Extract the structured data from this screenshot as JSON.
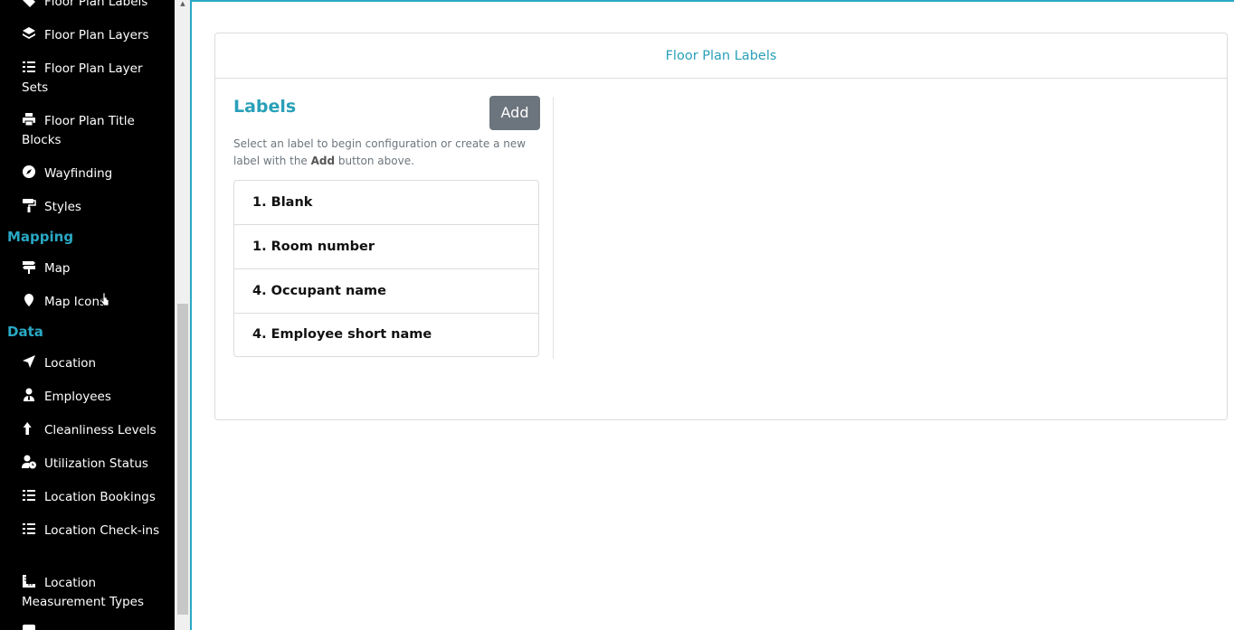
{
  "sidebar": {
    "items_top": [
      {
        "label": "Floor Plan Labels",
        "icon": "tag-icon"
      },
      {
        "label": "Floor Plan Layers",
        "icon": "layers-icon"
      },
      {
        "label": "Floor Plan Layer Sets",
        "icon": "list-check-icon"
      },
      {
        "label": "Floor Plan Title Blocks",
        "icon": "print-icon"
      },
      {
        "label": "Wayfinding",
        "icon": "compass-icon"
      },
      {
        "label": "Styles",
        "icon": "paint-roller-icon"
      }
    ],
    "section_mapping": "Mapping",
    "items_mapping": [
      {
        "label": "Map",
        "icon": "signpost-icon"
      },
      {
        "label": "Map Icons",
        "icon": "map-marker-icon"
      }
    ],
    "section_data": "Data",
    "items_data": [
      {
        "label": "Location",
        "icon": "location-arrow-icon"
      },
      {
        "label": "Employees",
        "icon": "user-tie-icon"
      },
      {
        "label": "Cleanliness Levels",
        "icon": "arrow-up-icon"
      },
      {
        "label": "Utilization Status",
        "icon": "user-clock-icon"
      },
      {
        "label": "Location Bookings",
        "icon": "list-icon"
      },
      {
        "label": "Location Check-ins",
        "icon": "list-icon"
      },
      {
        "label": "Location Measurement Types",
        "icon": "ruler-combined-icon"
      }
    ]
  },
  "main": {
    "card_title": "Floor Plan Labels",
    "labels_heading": "Labels",
    "add_label": "Add",
    "help_text_before": "Select an label to begin configuration or create a new label with the ",
    "help_text_bold": "Add",
    "help_text_after": " button above.",
    "labels": [
      "1. Blank",
      "1. Room number",
      "4. Occupant name",
      "4. Employee short name"
    ]
  },
  "colors": {
    "accent": "#29a8c4",
    "button_gray": "#6c757d",
    "sidebar_bg": "#000000"
  }
}
